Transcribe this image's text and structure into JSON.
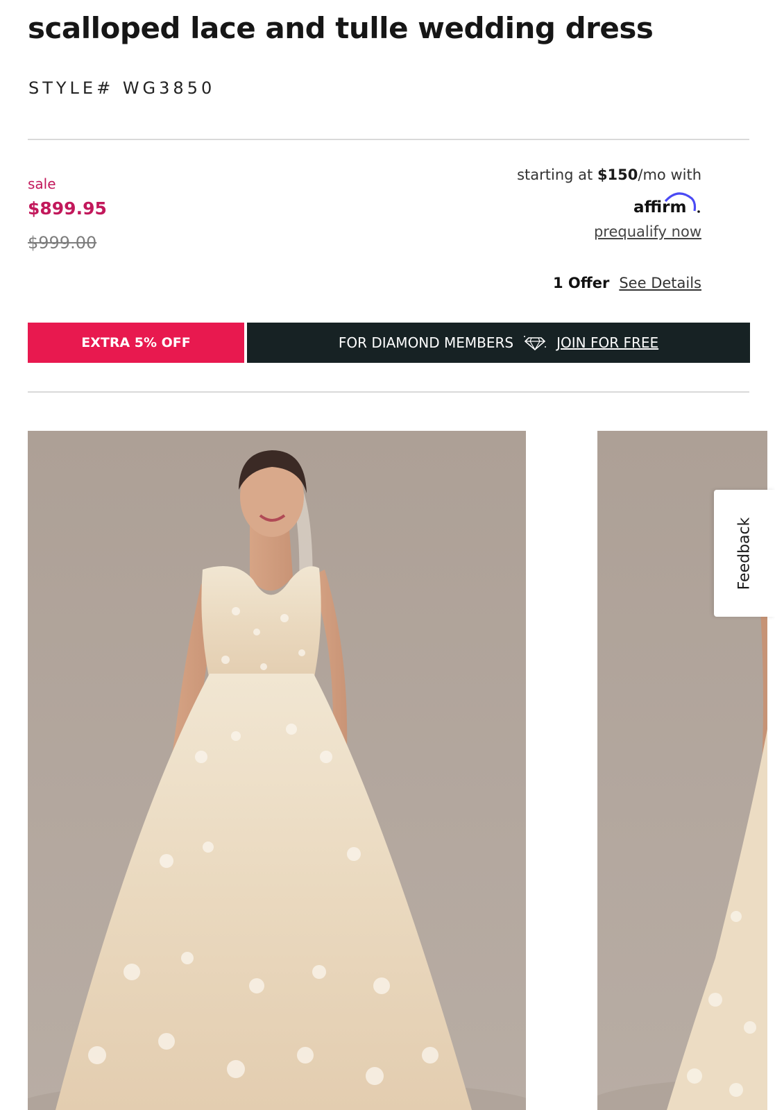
{
  "product": {
    "title": "scalloped lace and tulle wedding dress",
    "style_number": "STYLE# WG3850"
  },
  "pricing": {
    "sale_label": "sale",
    "sale_price": "$899.95",
    "original_price": "$999.00",
    "sale_color": "#c2185b"
  },
  "financing": {
    "prefix": "starting at ",
    "monthly_amount": "$150",
    "suffix": "/mo with",
    "provider_logo": "affirm",
    "prequalify_link": "prequalify now"
  },
  "offers": {
    "count_label": "1 Offer",
    "details_link": "See Details"
  },
  "promo_banner": {
    "discount_label": "EXTRA 5% OFF",
    "members_label": "FOR DIAMOND MEMBERS",
    "icon": "diamond-icon",
    "join_link": "JOIN FOR FREE",
    "discount_color": "#e8194f",
    "members_bg_color": "#172224"
  },
  "gallery": {
    "images": [
      {
        "name": "main-product-photo"
      },
      {
        "name": "secondary-product-photo"
      }
    ]
  },
  "feedback_tab": {
    "label": "Feedback"
  }
}
